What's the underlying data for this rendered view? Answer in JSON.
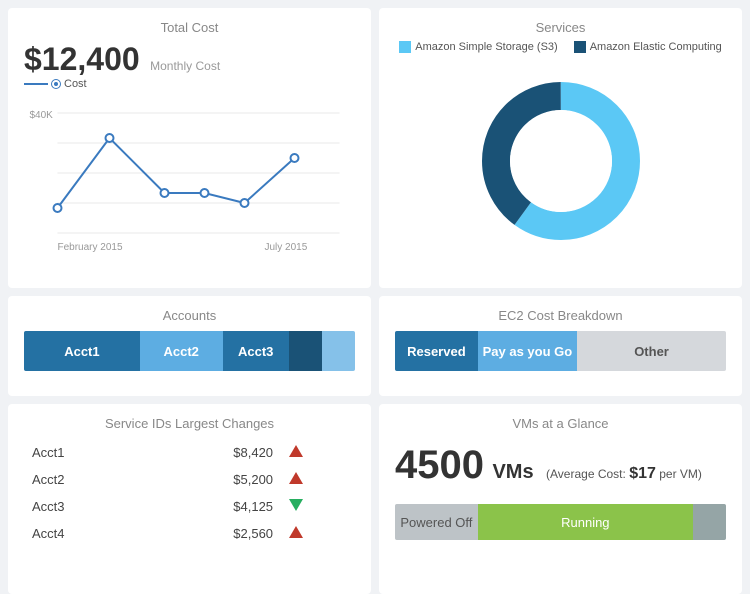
{
  "total_cost": {
    "title": "Total Cost",
    "amount": "$12,400",
    "monthly_label": "Monthly Cost",
    "legend_label": "Cost",
    "x_labels": [
      "February 2015",
      "July 2015"
    ],
    "y_label": "$40K"
  },
  "services": {
    "title": "Services",
    "legend": [
      {
        "label": "Amazon Simple Storage (S3)",
        "color": "#5bc8f5"
      },
      {
        "label": "Amazon Elastic Computing",
        "color": "#1a5276"
      }
    ],
    "s3_percent": 60,
    "ec2_percent": 40
  },
  "accounts": {
    "title": "Accounts",
    "segments": [
      {
        "label": "Acct1",
        "color": "#2471a3",
        "flex": 35
      },
      {
        "label": "Acct2",
        "color": "#5dade2",
        "flex": 25
      },
      {
        "label": "Acct3",
        "color": "#2471a3",
        "flex": 20
      },
      {
        "label": "",
        "color": "#1a5276",
        "flex": 10
      },
      {
        "label": "",
        "color": "#85c1e9",
        "flex": 10
      }
    ]
  },
  "ec2": {
    "title": "EC2 Cost Breakdown",
    "segments": [
      {
        "label": "Reserved",
        "color": "#2471a3",
        "flex": 25
      },
      {
        "label": "Pay as you Go",
        "color": "#5dade2",
        "flex": 30
      },
      {
        "label": "Other",
        "color": "#d5d8dc",
        "flex": 45,
        "text_color": "#555"
      }
    ]
  },
  "service_ids": {
    "title": "Service IDs Largest Changes",
    "rows": [
      {
        "name": "Acct1",
        "amount": "$8,420",
        "direction": "up"
      },
      {
        "name": "Acct2",
        "amount": "$5,200",
        "direction": "up"
      },
      {
        "name": "Acct3",
        "amount": "$4,125",
        "direction": "down"
      },
      {
        "name": "Acct4",
        "amount": "$2,560",
        "direction": "up"
      }
    ]
  },
  "vms": {
    "title": "VMs at a Glance",
    "count": "4500",
    "unit": "VMs",
    "avg_label": "Average Cost:",
    "avg_amount": "$17",
    "avg_per": "per VM",
    "bar_segments": [
      {
        "label": "Powered Off",
        "color": "#bdc3c7",
        "flex": 25
      },
      {
        "label": "Running",
        "color": "#8bc34a",
        "flex": 65
      },
      {
        "label": "",
        "color": "#95a5a6",
        "flex": 10
      }
    ]
  }
}
